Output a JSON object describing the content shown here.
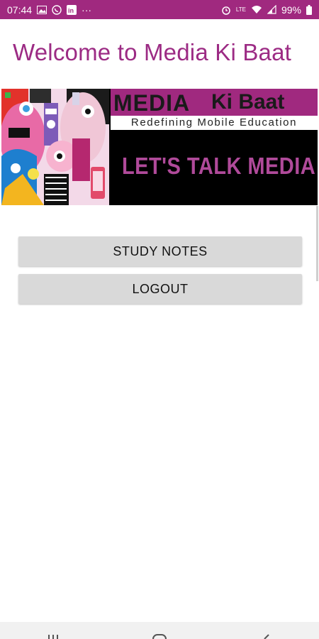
{
  "status_bar": {
    "time": "07:44",
    "more": "···",
    "battery": "99%",
    "network": "LTE"
  },
  "page": {
    "title": "Welcome to Media Ki Baat"
  },
  "banner": {
    "brand_media": "MEDIA",
    "brand_kibaat": "Ki Baat",
    "tagline": "Redefining Mobile Education",
    "headline": "LET'S TALK MEDIA"
  },
  "buttons": {
    "study_notes": "STUDY NOTES",
    "logout": "LOGOUT"
  },
  "colors": {
    "accent": "#a0297f",
    "title": "#9c2b84",
    "button_bg": "#d9d9d9"
  },
  "icons": {
    "status_left": [
      "image-icon",
      "whatsapp-icon",
      "linkedin-icon"
    ],
    "status_right": [
      "alarm-icon",
      "lte-icon",
      "wifi-icon",
      "signal-icon",
      "battery-icon"
    ],
    "nav": [
      "recents-icon",
      "home-icon",
      "back-icon"
    ]
  }
}
